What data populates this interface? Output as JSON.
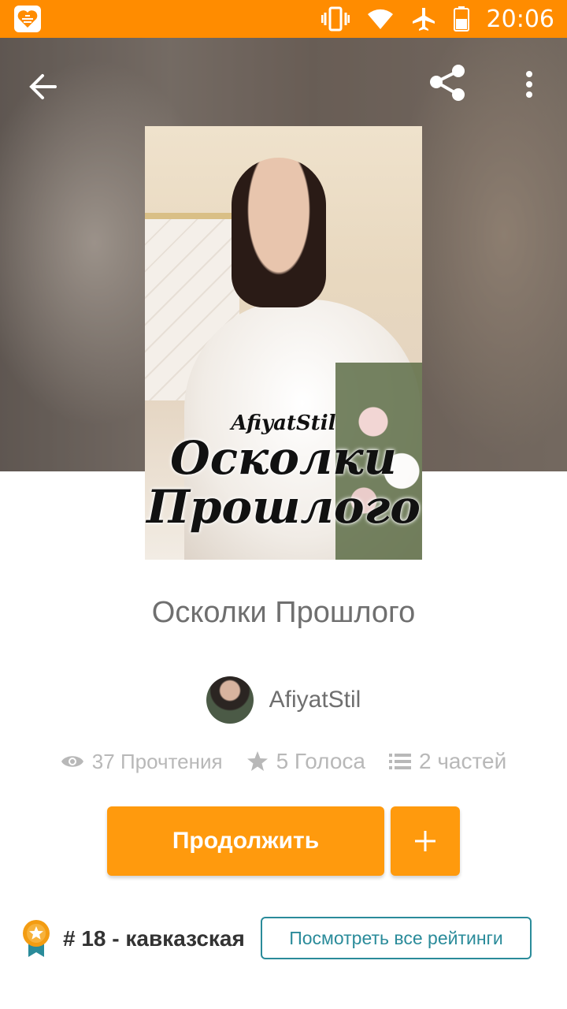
{
  "status_bar": {
    "time": "20:06",
    "icons": [
      "app-heart-icon",
      "vibrate-icon",
      "wifi-icon",
      "airplane-icon",
      "battery-icon"
    ],
    "bg_color": "#ff8c00"
  },
  "toolbar": {
    "icons": [
      "back-arrow-icon",
      "share-icon",
      "more-vert-icon"
    ]
  },
  "cover": {
    "author_text": "AfiyatStil",
    "title_line1": "Осколки",
    "title_line2": "Прошлого"
  },
  "book": {
    "title": "Осколки Прошлого",
    "author": "AfiyatStil"
  },
  "stats": {
    "reads": "37 Прочтения",
    "votes": "5 Голоса",
    "parts": "2 частей"
  },
  "actions": {
    "continue_label": "Продолжить",
    "add_label": "+"
  },
  "ranking": {
    "rank_text": "# 18 - кавказская",
    "view_all_label": "Посмотреть все рейтинги"
  },
  "colors": {
    "accent": "#ff9a0d",
    "teal": "#2a8b9a"
  }
}
